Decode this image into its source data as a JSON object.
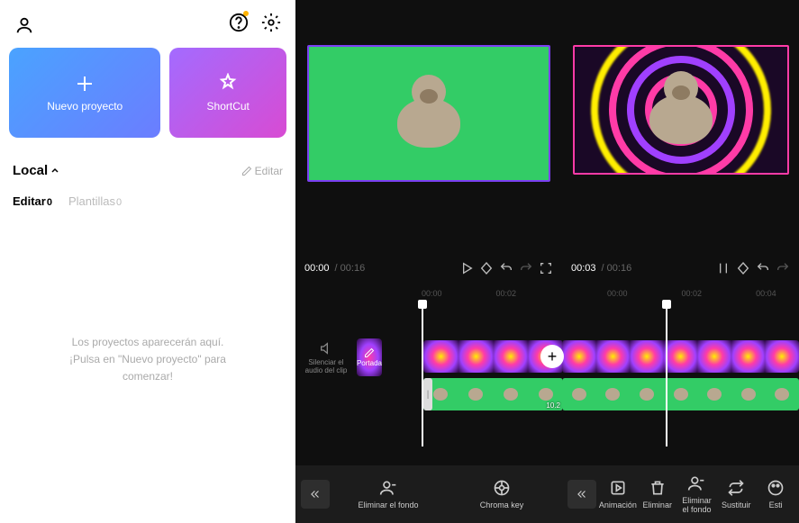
{
  "left": {
    "new_project_label": "Nuevo proyecto",
    "shortcut_label": "ShortCut",
    "section_title": "Local",
    "edit_label": "Editar",
    "tabs": [
      {
        "label": "Editar",
        "count": "0",
        "active": true
      },
      {
        "label": "Plantillas",
        "count": "0",
        "active": false
      }
    ],
    "empty_line1": "Los proyectos aparecerán aquí.",
    "empty_line2": "¡Pulsa en \"Nuevo proyecto\" para comenzar!"
  },
  "mid": {
    "time_current": "00:00",
    "time_total": "00:16",
    "ruler": [
      "00:00",
      "00:02"
    ],
    "mute_label": "Silenciar el audio del clip",
    "cover_label": "Portada",
    "clip_duration": "10.2",
    "tools": [
      {
        "name": "remove-bg",
        "label": "Eliminar el fondo"
      },
      {
        "name": "chroma-key",
        "label": "Chroma key"
      }
    ]
  },
  "right": {
    "time_current": "00:03",
    "time_total": "00:16",
    "ruler": [
      "00:00",
      "00:02",
      "00:04"
    ],
    "tools": [
      {
        "name": "animation",
        "label": "Animación"
      },
      {
        "name": "delete",
        "label": "Eliminar"
      },
      {
        "name": "remove-bg",
        "label": "Eliminar el fondo"
      },
      {
        "name": "replace",
        "label": "Sustituir"
      },
      {
        "name": "style",
        "label": "Esti"
      }
    ]
  }
}
